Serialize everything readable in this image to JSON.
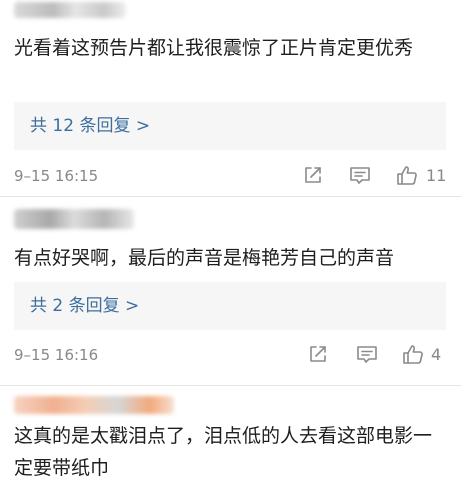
{
  "comments": [
    {
      "text": "光看着这预告片都让我很震惊了正片肯定更优秀",
      "reply_label": "共 12 条回复 >",
      "timestamp": "9–15 16:15",
      "like_count": "11"
    },
    {
      "text": "有点好哭啊，最后的声音是梅艳芳自己的声音",
      "reply_label": "共 2 条回复 >",
      "timestamp": "9–15 16:16",
      "like_count": "4"
    },
    {
      "text": "这真的是太戳泪点了，泪点低的人去看这部电影一定要带纸巾"
    }
  ],
  "colors": {
    "reply_link": "#3d6e9e",
    "meta_gray": "#888888",
    "reply_bg": "#f6f6f6",
    "text": "#1e1e1e"
  },
  "icons": {
    "share": "share-icon",
    "comment": "comment-icon",
    "like": "thumbs-up-icon"
  }
}
